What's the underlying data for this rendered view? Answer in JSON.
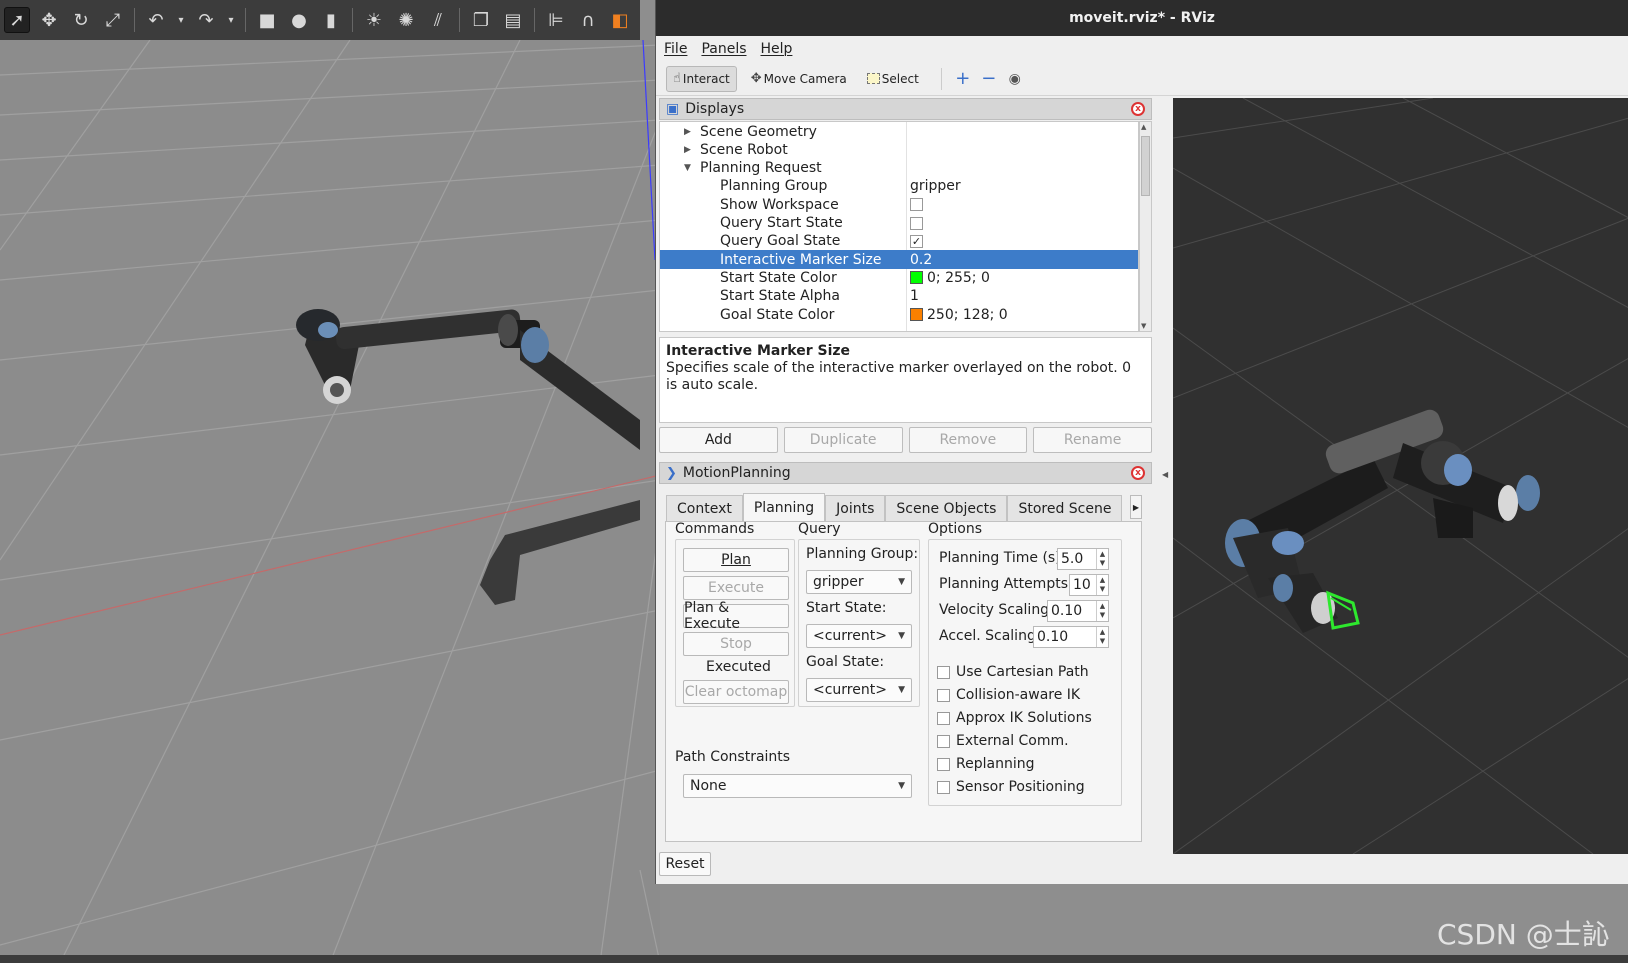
{
  "gazebo": {
    "toolbar_icons": [
      "select-arrow-icon",
      "translate-icon",
      "rotate-icon",
      "scale-icon",
      "undo-icon",
      "undo-menu-icon",
      "redo-icon",
      "redo-menu-icon",
      "box-icon",
      "sphere-icon",
      "cylinder-icon",
      "point-light-icon",
      "spot-light-icon",
      "directional-light-icon",
      "copy-icon",
      "paste-icon",
      "align-icon",
      "snap-icon",
      "view-angle-icon"
    ]
  },
  "rviz": {
    "title": "moveit.rviz* - RViz",
    "menu": [
      "File",
      "Panels",
      "Help"
    ],
    "toolbar": {
      "interact": "Interact",
      "move_camera": "Move Camera",
      "select": "Select"
    },
    "displays": {
      "title": "Displays",
      "tree": [
        {
          "name": "Scene Geometry",
          "value": "",
          "level": 1,
          "arrow": "collapsed"
        },
        {
          "name": "Scene Robot",
          "value": "",
          "level": 1,
          "arrow": "collapsed"
        },
        {
          "name": "Planning Request",
          "value": "",
          "level": 1,
          "arrow": "expanded"
        },
        {
          "name": "Planning Group",
          "value": "gripper",
          "level": 2
        },
        {
          "name": "Show Workspace",
          "value": "",
          "level": 2,
          "checkbox": false
        },
        {
          "name": "Query Start State",
          "value": "",
          "level": 2,
          "checkbox": false
        },
        {
          "name": "Query Goal State",
          "value": "",
          "level": 2,
          "checkbox": true
        },
        {
          "name": "Interactive Marker Size",
          "value": "0.2",
          "level": 2,
          "selected": true
        },
        {
          "name": "Start State Color",
          "value": "0; 255; 0",
          "level": 2,
          "swatch": "#00ff00"
        },
        {
          "name": "Start State Alpha",
          "value": "1",
          "level": 2
        },
        {
          "name": "Goal State Color",
          "value": "250; 128; 0",
          "level": 2,
          "swatch": "#fa8000"
        }
      ],
      "description_title": "Interactive Marker Size",
      "description_text": "Specifies scale of the interactive marker overlayed on the robot. 0 is auto scale.",
      "buttons": {
        "add": "Add",
        "duplicate": "Duplicate",
        "remove": "Remove",
        "rename": "Rename"
      }
    },
    "motion_planning": {
      "title": "MotionPlanning",
      "tabs": [
        "Context",
        "Planning",
        "Joints",
        "Scene Objects",
        "Stored Scene"
      ],
      "active_tab": "Planning",
      "commands": {
        "title": "Commands",
        "plan": "Plan",
        "execute": "Execute",
        "plan_execute": "Plan & Execute",
        "stop": "Stop",
        "status": "Executed",
        "clear_octomap": "Clear octomap"
      },
      "query": {
        "title": "Query",
        "planning_group_label": "Planning Group:",
        "planning_group_value": "gripper",
        "start_state_label": "Start State:",
        "start_state_value": "<current>",
        "goal_state_label": "Goal State:",
        "goal_state_value": "<current>"
      },
      "options": {
        "title": "Options",
        "planning_time_label": "Planning Time (s):",
        "planning_time_value": "5.0",
        "planning_attempts_label": "Planning Attempts:",
        "planning_attempts_value": "10",
        "velocity_scaling_label": "Velocity Scaling:",
        "velocity_scaling_value": "0.10",
        "accel_scaling_label": "Accel. Scaling:",
        "accel_scaling_value": "0.10",
        "checkboxes": [
          {
            "label": "Use Cartesian Path",
            "checked": false
          },
          {
            "label": "Collision-aware IK",
            "checked": false
          },
          {
            "label": "Approx IK Solutions",
            "checked": false
          },
          {
            "label": "External Comm.",
            "checked": false
          },
          {
            "label": "Replanning",
            "checked": false
          },
          {
            "label": "Sensor Positioning",
            "checked": false
          }
        ]
      },
      "path_constraints": {
        "title": "Path Constraints",
        "value": "None"
      },
      "reset": "Reset"
    }
  },
  "watermark": "CSDN @士訫"
}
